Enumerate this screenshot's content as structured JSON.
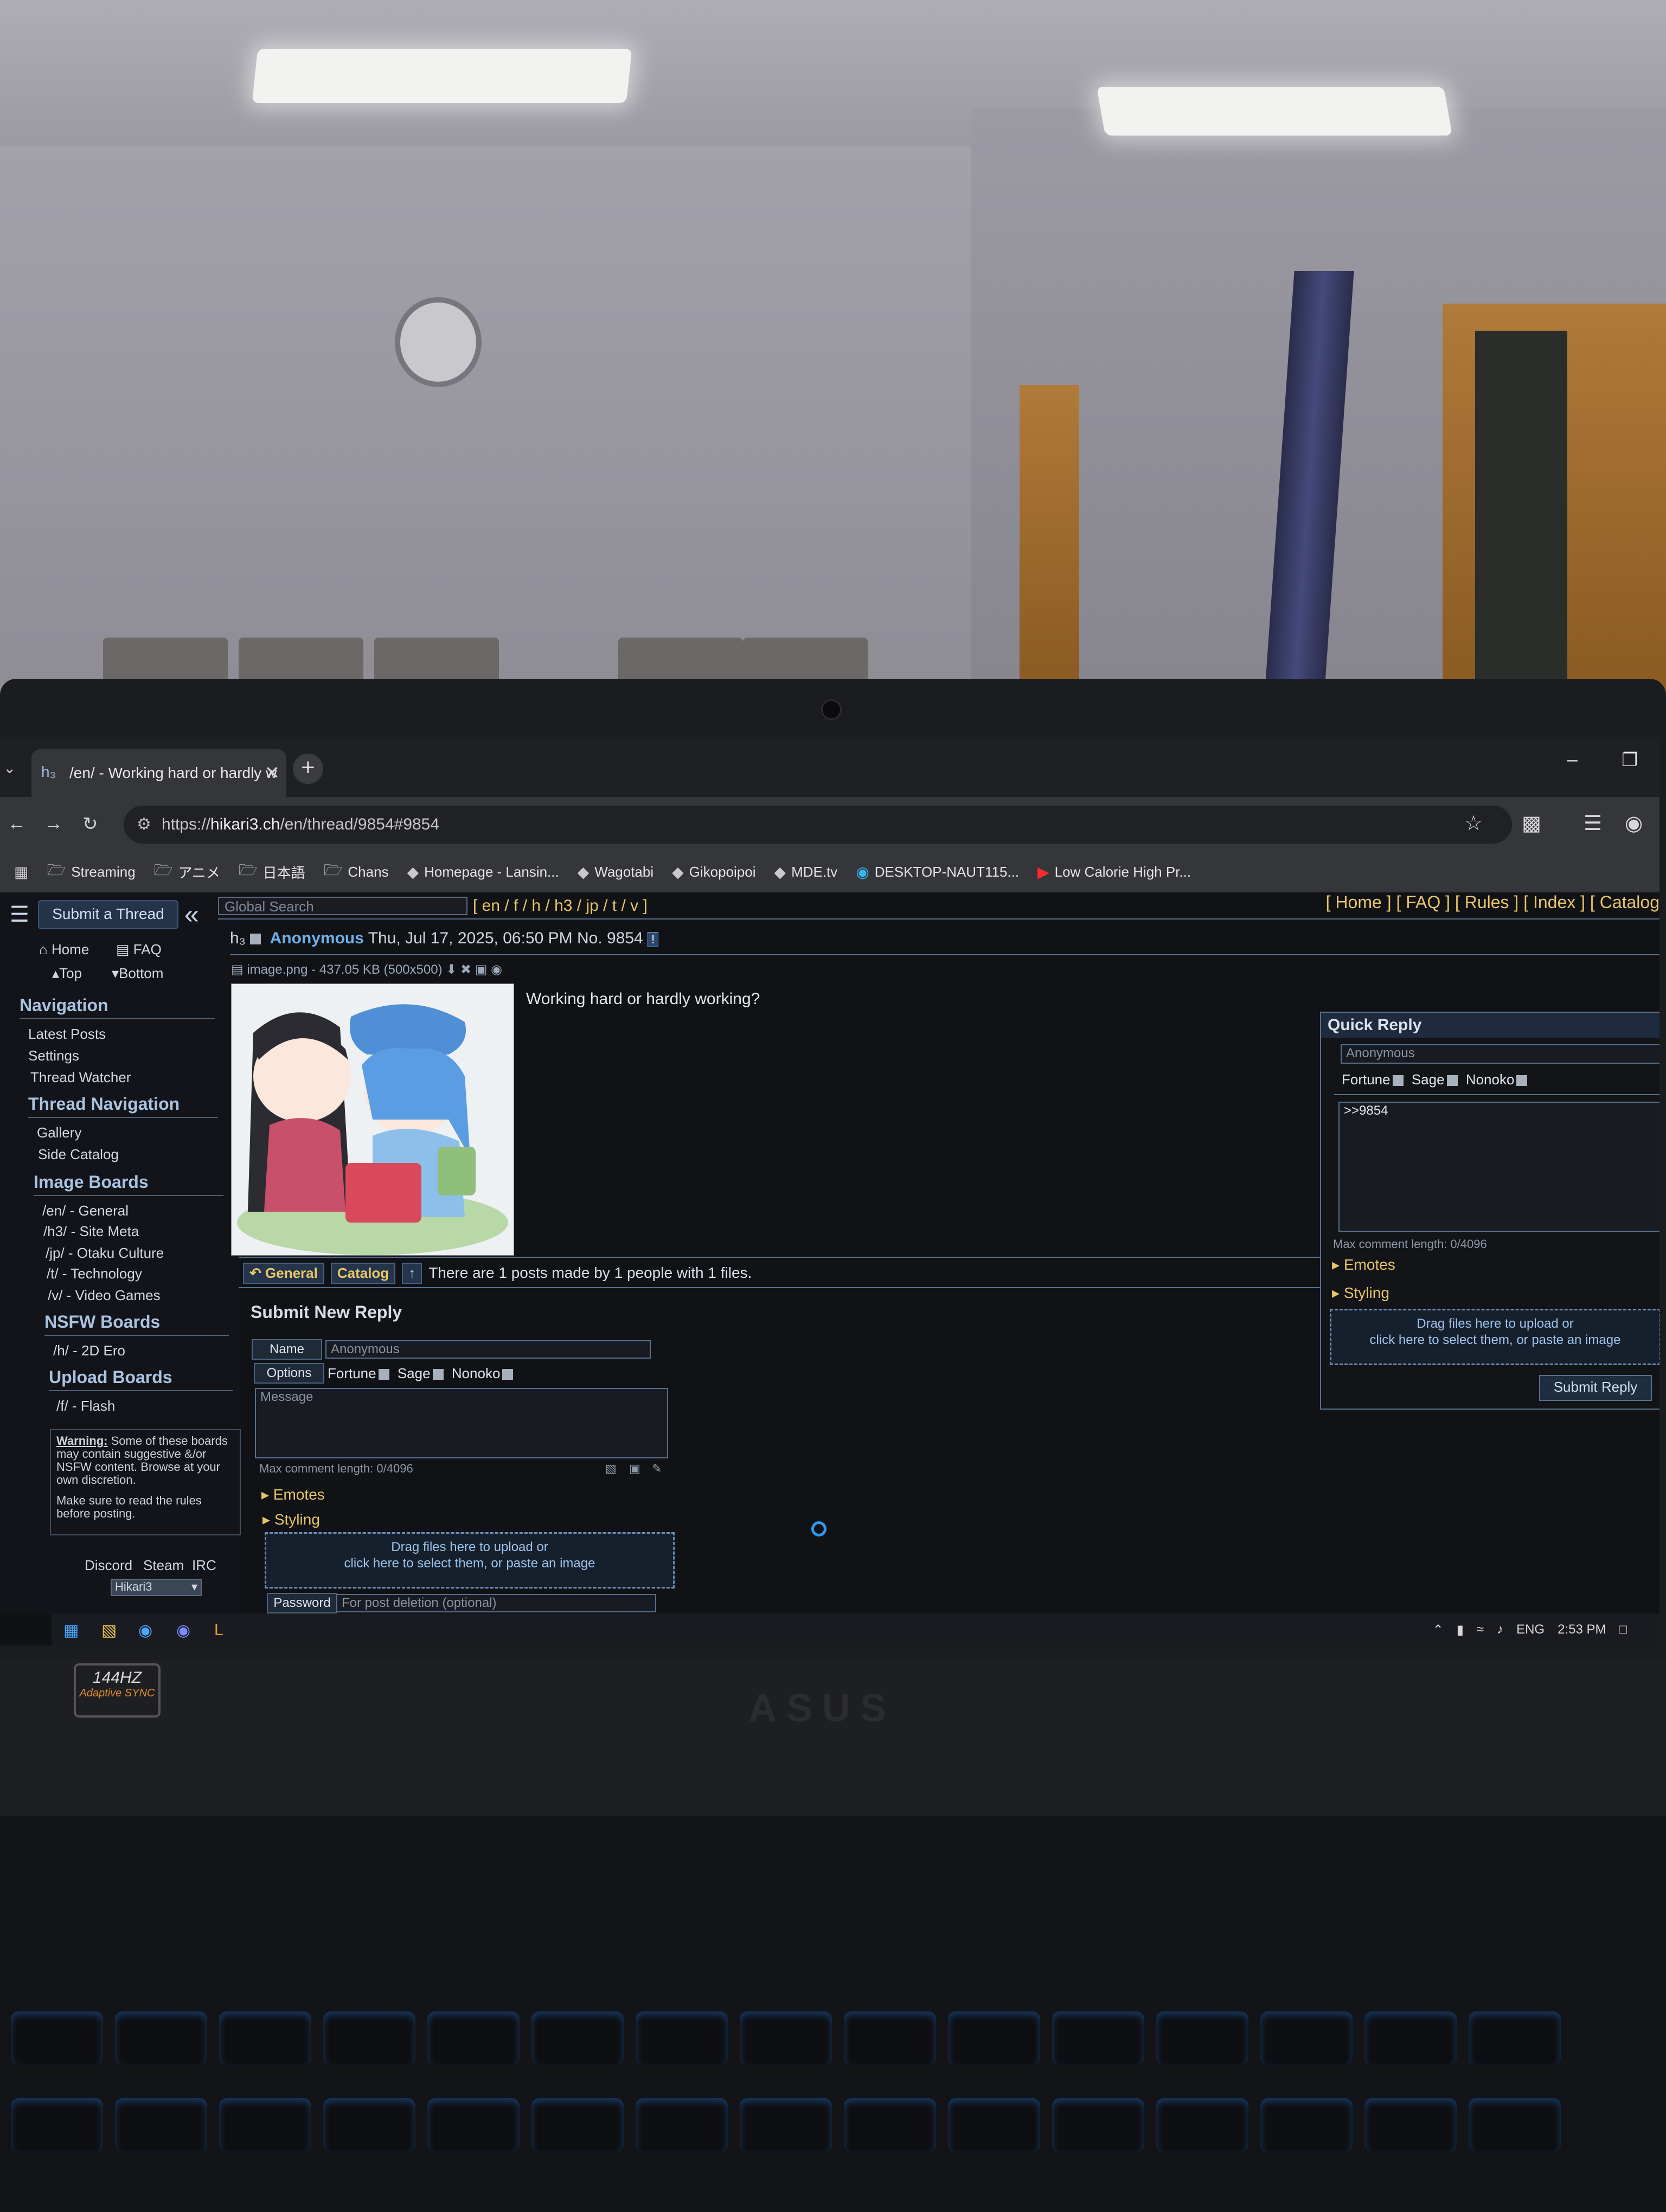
{
  "browser": {
    "tab_title": "/en/ - Working hard or hardly w",
    "tab_icon": "hikari-favicon",
    "url_host": "hikari3.ch",
    "url_prefix": "https://",
    "url_path": "/en/thread/9854#9854",
    "bookmarks": [
      {
        "icon": "folder-icon",
        "label": "Streaming"
      },
      {
        "icon": "folder-icon",
        "label": "アニメ"
      },
      {
        "icon": "folder-icon",
        "label": "日本語"
      },
      {
        "icon": "folder-icon",
        "label": "Chans"
      },
      {
        "icon": "site-icon",
        "label": "Homepage - Lansin..."
      },
      {
        "icon": "site-icon",
        "label": "Wagotabi"
      },
      {
        "icon": "site-icon",
        "label": "Gikopoipoi"
      },
      {
        "icon": "site-icon",
        "label": "MDE.tv"
      },
      {
        "icon": "site-icon",
        "label": "DESKTOP-NAUT115..."
      },
      {
        "icon": "youtube-icon",
        "label": "Low Calorie High Pr..."
      }
    ]
  },
  "sidebar": {
    "submit_thread": "Submit a Thread",
    "home": "Home",
    "faq": "FAQ",
    "top": "Top",
    "bottom": "Bottom",
    "navigation_title": "Navigation",
    "navigation_items": [
      "Latest Posts",
      "Settings",
      "Thread Watcher"
    ],
    "thread_nav_title": "Thread Navigation",
    "thread_nav_items": [
      "Gallery",
      "Side Catalog"
    ],
    "image_boards_title": "Image Boards",
    "image_boards": [
      "/en/ - General",
      "/h3/ - Site Meta",
      "/jp/ - Otaku Culture",
      "/t/ - Technology",
      "/v/ - Video Games"
    ],
    "nsfw_title": "NSFW Boards",
    "nsfw_boards": [
      "/h/ - 2D Ero"
    ],
    "upload_title": "Upload Boards",
    "upload_boards": [
      "/f/ - Flash"
    ],
    "warning_label": "Warning:",
    "warning_text": "Some of these boards may contain suggestive &/or NSFW content. Browse at your own discretion.",
    "warning_rules": "Make sure to read the rules before posting.",
    "footer_links": [
      "Discord",
      "Steam",
      "IRC"
    ],
    "theme_select": "Hikari3"
  },
  "topbar": {
    "search_placeholder": "Global Search",
    "board_links": "[ en / f / h / h3 / jp / t / v ]",
    "site_links": "[ Home ] [ FAQ ] [ Rules ] [ Index ] [ Catalog"
  },
  "post": {
    "name": "Anonymous",
    "date": "Thu, Jul 17, 2025, 06:50 PM",
    "number": "No. 9854",
    "report": "!",
    "file_info": "image.png - 437.05 KB (500x500)",
    "body": "Working hard or hardly working?"
  },
  "thread_bar": {
    "general": "General",
    "catalog": "Catalog",
    "stats": "There are 1 posts made by 1 people with 1 files."
  },
  "reply_form": {
    "title": "Submit New Reply",
    "name_label": "Name",
    "name_placeholder": "Anonymous",
    "options_label": "Options",
    "options": [
      "Fortune",
      "Sage",
      "Nonoko"
    ],
    "message_placeholder": "Message",
    "max_length": "Max comment length: 0/4096",
    "emotes": "Emotes",
    "styling": "Styling",
    "drop_line1": "Drag files here to upload or",
    "drop_line2": "click here to select them, or paste an image",
    "password_label": "Password",
    "password_placeholder": "For post deletion (optional)"
  },
  "quick_reply": {
    "title": "Quick Reply",
    "name_placeholder": "Anonymous",
    "options": [
      "Fortune",
      "Sage",
      "Nonoko"
    ],
    "message": ">>9854",
    "max_length": "Max comment length: 0/4096",
    "emotes": "Emotes",
    "styling": "Styling",
    "drop_line1": "Drag files here to upload or",
    "drop_line2": "click here to select them, or paste an image",
    "submit": "Submit Reply"
  },
  "taskbar": {
    "language": "ENG",
    "time": "2:53 PM"
  },
  "hardware": {
    "sticker_line1": "144HZ",
    "sticker_line2": "Adaptive SYNC"
  },
  "colors": {
    "accent": "#e8c568",
    "name": "#6fb1e8",
    "page_bg": "#101216"
  }
}
